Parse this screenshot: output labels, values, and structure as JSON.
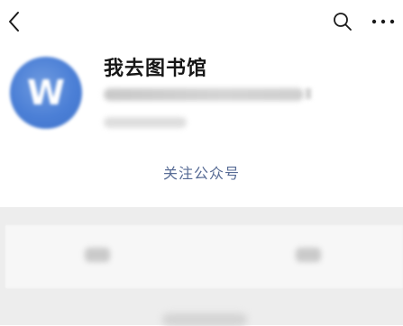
{
  "topbar": {
    "back_icon": "chevron-left-icon",
    "search_icon": "search-icon",
    "more_icon": "more-horizontal-icon"
  },
  "profile": {
    "avatar_letter": "W",
    "name": "我去图书馆",
    "follow_label": "关注公众号"
  },
  "colors": {
    "link": "#576b95",
    "avatar": "#4b7fd6",
    "section_bg": "#ededed"
  }
}
